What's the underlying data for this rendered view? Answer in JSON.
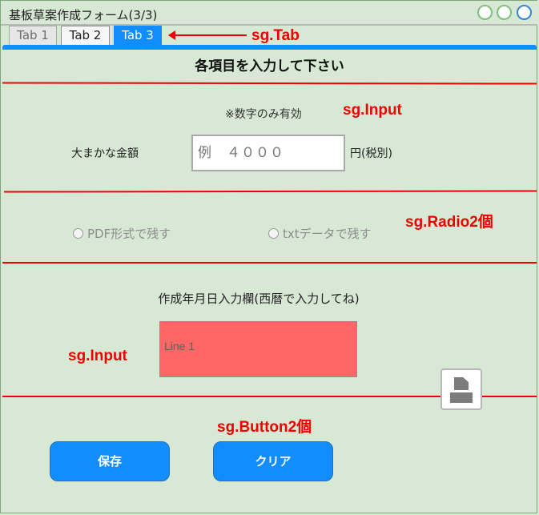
{
  "window": {
    "title": "基板草案作成フォーム(3/3)"
  },
  "tabs": [
    {
      "label": "Tab 1"
    },
    {
      "label": "Tab 2"
    },
    {
      "label": "Tab 3",
      "selected": true
    }
  ],
  "form": {
    "heading": "各項目を入力して下さい",
    "amount": {
      "hint": "※数字のみ有効",
      "label": "大まかな金額",
      "placeholder": "例　４０００",
      "unit": "円(税別)"
    },
    "radios": [
      {
        "label": "PDF形式で残す",
        "checked": false
      },
      {
        "label": "txtデータで残す",
        "checked": false
      }
    ],
    "date": {
      "label": "作成年月日入力欄(西暦で入力してね)",
      "value": "Line 1"
    },
    "buttons": {
      "save": "保存",
      "clear": "クリア"
    }
  },
  "annotations": {
    "tab": "sg.Tab",
    "input_top": "sg.Input",
    "radio": "sg.Radio2個",
    "input_bottom": "sg.Input",
    "button": "sg.Button2個"
  },
  "colors": {
    "background": "#d7e8d4",
    "accent": "#118dff",
    "annotation": "#ee0000",
    "date_field": "#ff6767"
  }
}
